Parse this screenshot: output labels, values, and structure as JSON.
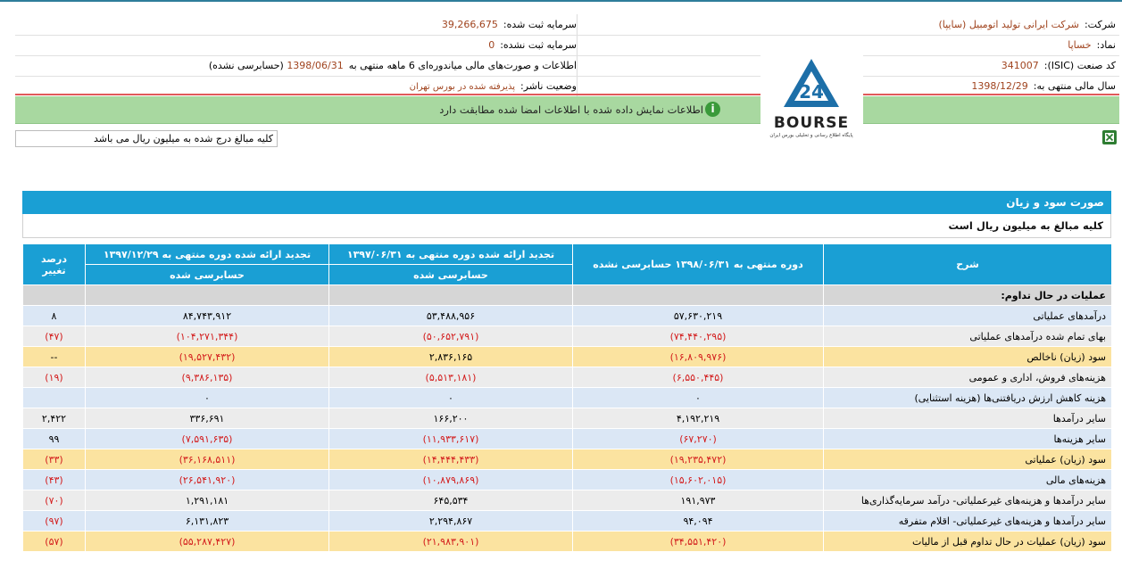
{
  "header": {
    "company_label": "شرکت:",
    "company_value": "شرکت ایرانی تولید اتومبیل (سایپا)",
    "symbol_label": "نماد:",
    "symbol_value": "خساپا",
    "isic_label": "کد صنعت (ISIC):",
    "isic_value": "341007",
    "fiscal_label": "سال مالی منتهی به:",
    "fiscal_value": "1398/12/29",
    "capital_registered_label": "سرمایه ثبت شده:",
    "capital_registered_value": "39,266,675",
    "capital_unregistered_label": "سرمایه ثبت نشده:",
    "capital_unregistered_value": "0",
    "report_label": "اطلاعات و صورت‌های مالی میاندوره‌ای 6 ماهه منتهی به",
    "report_date": "1398/06/31",
    "report_suffix": "(حسابرسی نشده)",
    "publisher_label": "وضعیت ناشر:",
    "publisher_value": "پذیرفته شده در بورس تهران"
  },
  "notice": {
    "text": "اطلاعات نمایش داده شده با اطلاعات امضا شده مطابقت دارد",
    "icon": "info-icon"
  },
  "logo": {
    "text": "BOURSE",
    "number": "24",
    "tagline": "پایگاه اطلاع رسانی و تحلیلی بورس ایران",
    "color": "#1d6fa8"
  },
  "amount_note": "کلیه مبالغ درج شده به میلیون ریال می باشد",
  "statement": {
    "title": "صورت سود و زیان",
    "subtitle": "کلیه مبالغ به میلیون ریال است",
    "headers": {
      "desc": "شرح",
      "col1_title": "دوره منتهی به ۱۳۹۸/۰۶/۳۱ حسابرسی نشده",
      "col2_title": "تجدید ارائه شده دوره منتهی به ۱۳۹۷/۰۶/۳۱",
      "col2_sub": "حسابرسی شده",
      "col3_title": "تجدید ارائه شده دوره منتهی به ۱۳۹۷/۱۲/۲۹",
      "col3_sub": "حسابرسی شده",
      "change": "درصد تغییر"
    },
    "section_title": "عملیات در حال تداوم:",
    "rows": [
      {
        "desc": "درآمدهای عملیاتی",
        "c1": "۵۷,۶۳۰,۲۱۹",
        "c2": "۵۳,۴۸۸,۹۵۶",
        "c3": "۸۴,۷۴۳,۹۱۲",
        "ch": "۸",
        "style": "blue"
      },
      {
        "desc": "بهای تمام شده درآمدهای عملیاتی",
        "c1": "(۷۴,۴۴۰,۲۹۵)",
        "c2": "(۵۰,۶۵۲,۷۹۱)",
        "c3": "(۱۰۴,۲۷۱,۳۴۴)",
        "ch": "(۴۷)",
        "style": "grey"
      },
      {
        "desc": "سود (زیان) ناخالص",
        "c1": "(۱۶,۸۰۹,۹۷۶)",
        "c2": "۲,۸۳۶,۱۶۵",
        "c3": "(۱۹,۵۲۷,۴۳۲)",
        "ch": "--",
        "style": "yellow"
      },
      {
        "desc": "هزینه‌های فروش، اداری و عمومی",
        "c1": "(۶,۵۵۰,۴۴۵)",
        "c2": "(۵,۵۱۳,۱۸۱)",
        "c3": "(۹,۳۸۶,۱۳۵)",
        "ch": "(۱۹)",
        "style": "grey"
      },
      {
        "desc": "هزینه کاهش ارزش دریافتنی‌ها (هزینه استثنایی)",
        "c1": "۰",
        "c2": "۰",
        "c3": "۰",
        "ch": "",
        "style": "blue"
      },
      {
        "desc": "سایر درآمدها",
        "c1": "۴,۱۹۲,۲۱۹",
        "c2": "۱۶۶,۲۰۰",
        "c3": "۳۳۶,۶۹۱",
        "ch": "۲,۴۲۲",
        "style": "grey"
      },
      {
        "desc": "سایر هزینه‌ها",
        "c1": "(۶۷,۲۷۰)",
        "c2": "(۱۱,۹۳۳,۶۱۷)",
        "c3": "(۷,۵۹۱,۶۳۵)",
        "ch": "۹۹",
        "style": "blue"
      },
      {
        "desc": "سود (زیان) عملیاتی",
        "c1": "(۱۹,۲۳۵,۴۷۲)",
        "c2": "(۱۴,۴۴۴,۴۳۳)",
        "c3": "(۳۶,۱۶۸,۵۱۱)",
        "ch": "(۳۳)",
        "style": "yellow"
      },
      {
        "desc": "هزینه‌های مالی",
        "c1": "(۱۵,۶۰۲,۰۱۵)",
        "c2": "(۱۰,۸۷۹,۸۶۹)",
        "c3": "(۲۶,۵۴۱,۹۲۰)",
        "ch": "(۴۳)",
        "style": "blue"
      },
      {
        "desc": "سایر درآمدها و هزینه‌های غیرعملیاتی- درآمد سرمایه‌گذاری‌ها",
        "c1": "۱۹۱,۹۷۳",
        "c2": "۶۴۵,۵۳۴",
        "c3": "۱,۲۹۱,۱۸۱",
        "ch": "(۷۰)",
        "style": "grey"
      },
      {
        "desc": "سایر درآمدها و هزینه‌های غیرعملیاتی- اقلام متفرقه",
        "c1": "۹۴,۰۹۴",
        "c2": "۲,۲۹۴,۸۶۷",
        "c3": "۶,۱۳۱,۸۲۳",
        "ch": "(۹۷)",
        "style": "blue"
      },
      {
        "desc": "سود (زیان) عملیات در حال تداوم قبل از مالیات",
        "c1": "(۳۴,۵۵۱,۴۲۰)",
        "c2": "(۲۱,۹۸۳,۹۰۱)",
        "c3": "(۵۵,۲۸۷,۴۲۷)",
        "ch": "(۵۷)",
        "style": "yellow"
      }
    ]
  }
}
